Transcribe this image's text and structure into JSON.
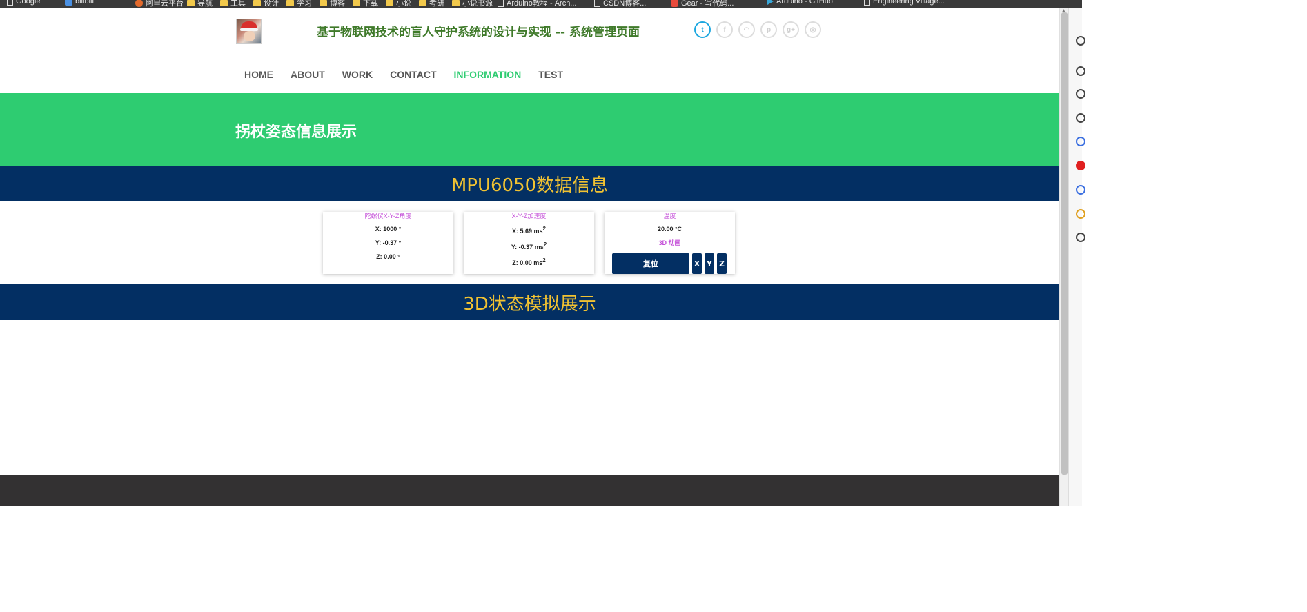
{
  "bookmarks": [
    {
      "label": "Google",
      "icon": "page-icon"
    },
    {
      "label": "bilibili",
      "icon": "blue-icon"
    },
    {
      "label": "阿里云平台",
      "icon": "orange-icon"
    },
    {
      "label": "导航",
      "icon": "folder-icon"
    },
    {
      "label": "工具",
      "icon": "folder-icon"
    },
    {
      "label": "设计",
      "icon": "folder-icon"
    },
    {
      "label": "学习",
      "icon": "folder-icon"
    },
    {
      "label": "博客",
      "icon": "folder-icon"
    },
    {
      "label": "下载",
      "icon": "folder-icon"
    },
    {
      "label": "小说",
      "icon": "folder-icon"
    },
    {
      "label": "考研",
      "icon": "folder-icon"
    },
    {
      "label": "小说书源",
      "icon": "folder-icon"
    },
    {
      "label": "Arduino教程 - Arch...",
      "icon": "page-icon"
    },
    {
      "label": "CSDN博客...",
      "icon": "page-icon"
    },
    {
      "label": "Gear - 写代码...",
      "icon": "red-icon"
    },
    {
      "label": "Arduino - GitHub",
      "icon": "cyan-icon"
    },
    {
      "label": "Engineering Village...",
      "icon": "page-icon"
    }
  ],
  "header": {
    "title": "基于物联网技术的盲人守护系统的设计与实现 -- 系统管理页面",
    "social_icons": [
      {
        "name": "twitter-icon",
        "glyph": "t",
        "active": true
      },
      {
        "name": "facebook-icon",
        "glyph": "f",
        "active": false
      },
      {
        "name": "rss-icon",
        "glyph": "◠",
        "active": false
      },
      {
        "name": "pinterest-icon",
        "glyph": "p",
        "active": false
      },
      {
        "name": "google-plus-icon",
        "glyph": "g+",
        "active": false
      },
      {
        "name": "dribbble-icon",
        "glyph": "◎",
        "active": false
      }
    ]
  },
  "nav": {
    "items": [
      {
        "label": "HOME",
        "active": false
      },
      {
        "label": "ABOUT",
        "active": false
      },
      {
        "label": "WORK",
        "active": false
      },
      {
        "label": "CONTACT",
        "active": false
      },
      {
        "label": "INFORMATION",
        "active": true
      },
      {
        "label": "TEST",
        "active": false
      }
    ]
  },
  "hero": {
    "title": "拐杖姿态信息展示"
  },
  "section_mpu": {
    "title": "MPU6050数据信息"
  },
  "cards": {
    "gyro": {
      "title": "陀螺仪X-Y-Z角度",
      "x": "X: 1000 °",
      "y": "Y: -0.37 °",
      "z": "Z: 0.00 °"
    },
    "accel": {
      "title": "X-Y-Z加速度",
      "x": "X: 5.69 ms",
      "y": "Y: -0.37 ms",
      "z": "Z: 0.00 ms",
      "unit_sup": "2"
    },
    "temp": {
      "title": "温度",
      "value": "20.00 °C",
      "anim_label": "3D 动画",
      "reset_label": "复位",
      "axis_x": "X",
      "axis_y": "Y",
      "axis_z": "Z"
    }
  },
  "section_3d": {
    "title": "3D状态模拟展示"
  },
  "colors": {
    "accent_green": "#2ecc71",
    "title_green": "#3f7a2a",
    "navy": "#032f63",
    "gold": "#f1c232",
    "card_title_purple": "#c44fd8",
    "footer": "#333132"
  }
}
